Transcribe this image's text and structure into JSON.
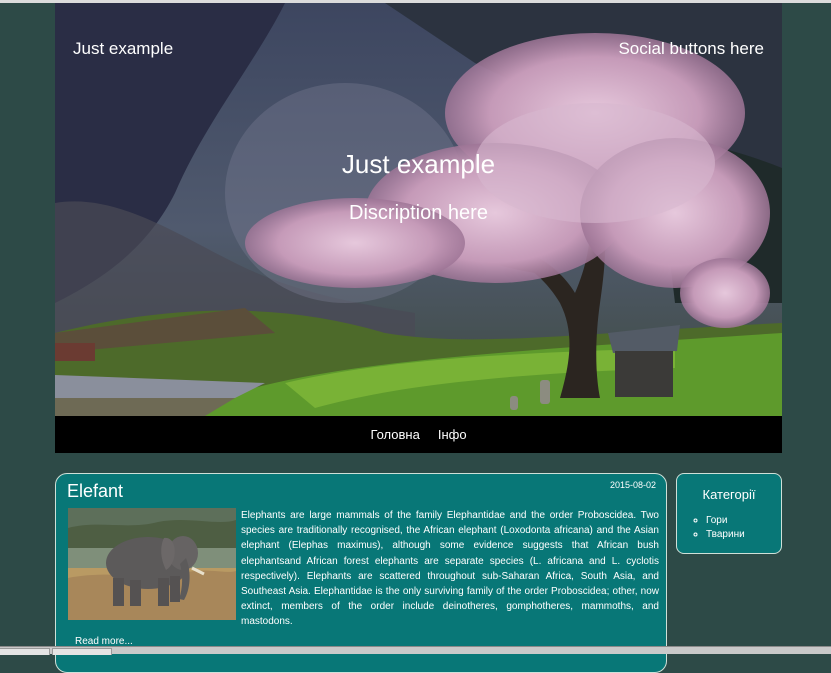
{
  "header": {
    "site_title": "Just example",
    "social_text": "Social buttons here",
    "hero_title": "Just example",
    "hero_description": "Discription here"
  },
  "nav": {
    "items": [
      {
        "label": "Головна"
      },
      {
        "label": "Інфо"
      }
    ]
  },
  "post": {
    "title": "Elefant",
    "date": "2015-08-02",
    "excerpt": "Elephants are large mammals of the family Elephantidae and the order Proboscidea. Two species are traditionally recognised, the African elephant (Loxodonta africana) and the Asian elephant (Elephas maximus), although some evidence suggests that African bush elephantsand African forest elephants are separate species (L. africana and L. cyclotis respectively). Elephants are scattered throughout sub-Saharan Africa, South Asia, and Southeast Asia. Elephantidae is the only surviving family of the order Proboscidea; other, now extinct, members of the order include deinotheres, gomphotheres, mammoths, and mastodons.",
    "read_more": "Read more..."
  },
  "sidebar": {
    "title": "Категорії",
    "categories": [
      {
        "label": "Гори"
      },
      {
        "label": "Тварини"
      }
    ]
  },
  "colors": {
    "page_background": "#2d4a47",
    "panel": "#087777",
    "nav_background": "#000000"
  }
}
